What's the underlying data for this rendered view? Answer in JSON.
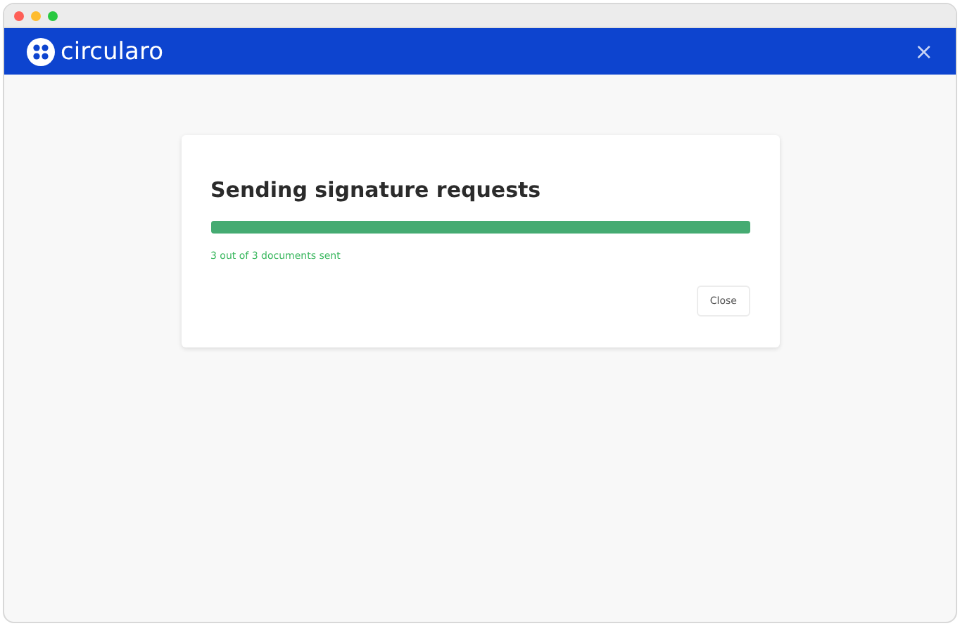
{
  "header": {
    "logo_text": "circularo",
    "close": "×"
  },
  "dialog": {
    "title": "Sending signature requests",
    "progress": {
      "level": 1.0
    },
    "status": "3 out of 3 documents sent",
    "buttons": [
      "Close"
    ]
  }
}
